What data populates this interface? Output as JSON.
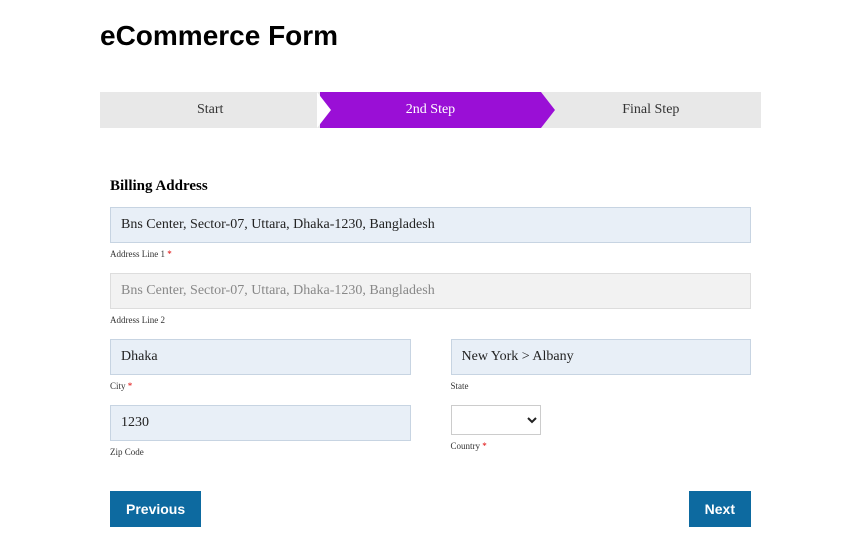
{
  "title": "eCommerce Form",
  "stepper": {
    "steps": [
      "Start",
      "2nd Step",
      "Final Step"
    ],
    "active_index": 1
  },
  "section_title": "Billing Address",
  "fields": {
    "address1": {
      "value": "Bns Center, Sector-07, Uttara, Dhaka-1230, Bangladesh",
      "label": "Address Line 1",
      "required": true
    },
    "address2": {
      "value": "",
      "placeholder": "Bns Center, Sector-07, Uttara, Dhaka-1230, Bangladesh",
      "label": "Address Line 2",
      "required": false
    },
    "city": {
      "value": "Dhaka",
      "label": "City",
      "required": true
    },
    "state": {
      "value": "New York > Albany",
      "label": "State",
      "required": false
    },
    "zip": {
      "value": "1230",
      "label": "Zip Code",
      "required": false
    },
    "country": {
      "value": "",
      "label": "Country",
      "required": true
    }
  },
  "buttons": {
    "previous": "Previous",
    "next": "Next"
  },
  "required_marker": "*"
}
